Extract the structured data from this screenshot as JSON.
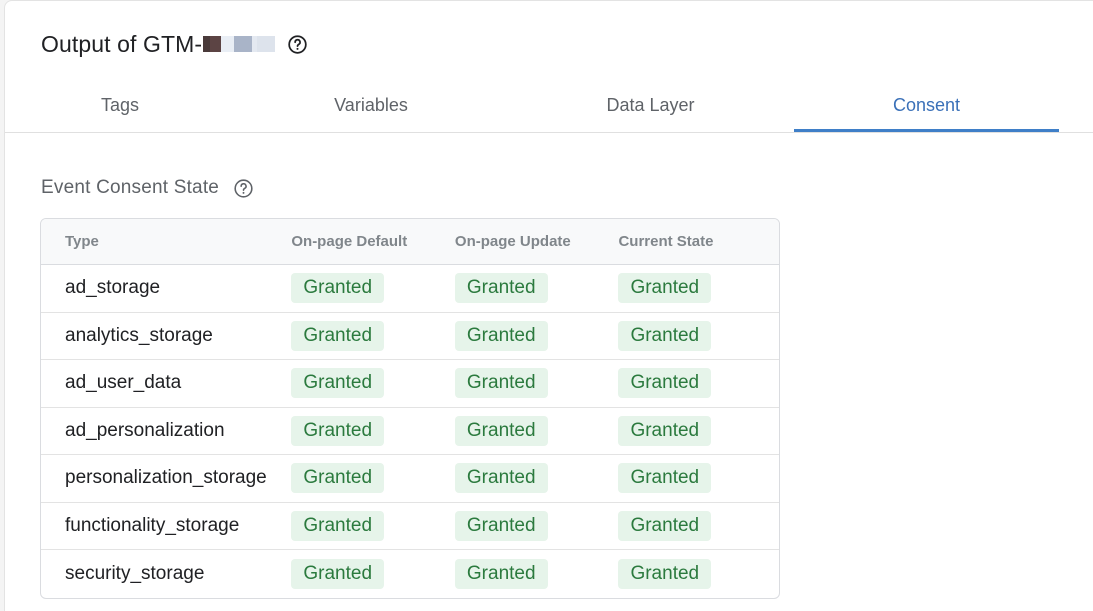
{
  "header": {
    "title_prefix": "Output of GTM-",
    "help_icon": "help-circle-icon"
  },
  "tabs": [
    {
      "label": "Tags",
      "active": false
    },
    {
      "label": "Variables",
      "active": false
    },
    {
      "label": "Data Layer",
      "active": false
    },
    {
      "label": "Consent",
      "active": true
    }
  ],
  "section": {
    "title": "Event Consent State",
    "help_icon": "help-circle-icon"
  },
  "table": {
    "headers": [
      "Type",
      "On-page Default",
      "On-page Update",
      "Current State"
    ],
    "rows": [
      {
        "type": "ad_storage",
        "default": "Granted",
        "update": "Granted",
        "current": "Granted"
      },
      {
        "type": "analytics_storage",
        "default": "Granted",
        "update": "Granted",
        "current": "Granted"
      },
      {
        "type": "ad_user_data",
        "default": "Granted",
        "update": "Granted",
        "current": "Granted"
      },
      {
        "type": "ad_personalization",
        "default": "Granted",
        "update": "Granted",
        "current": "Granted"
      },
      {
        "type": "personalization_storage",
        "default": "Granted",
        "update": "Granted",
        "current": "Granted"
      },
      {
        "type": "functionality_storage",
        "default": "Granted",
        "update": "Granted",
        "current": "Granted"
      },
      {
        "type": "security_storage",
        "default": "Granted",
        "update": "Granted",
        "current": "Granted"
      }
    ]
  },
  "colors": {
    "accent": "#3f7fc8",
    "granted_bg": "#e6f4ea",
    "granted_text": "#2b7a3e"
  }
}
